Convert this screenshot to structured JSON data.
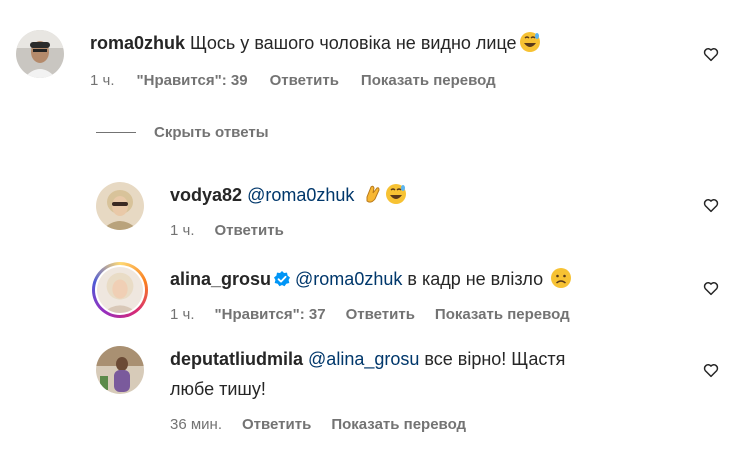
{
  "comments": [
    {
      "username": "roma0zhuk",
      "text": "Щось у вашого чоловіка не видно лице",
      "emoji": "grinning-sweat-emoji",
      "time": "1 ч.",
      "likes": "\"Нравится\": 39",
      "reply": "Ответить",
      "translate": "Показать перевод"
    },
    {
      "username": "vodya82",
      "mention": "@roma0zhuk",
      "emoji": [
        "clapping-hand-emoji",
        "grinning-sweat-emoji"
      ],
      "time": "1 ч.",
      "reply": "Ответить"
    },
    {
      "username": "alina_grosu",
      "verified": true,
      "mention": "@roma0zhuk",
      "text": "в кадр не влізло",
      "emoji": "sad-face-emoji",
      "time": "1 ч.",
      "likes": "\"Нравится\": 37",
      "reply": "Ответить",
      "translate": "Показать перевод"
    },
    {
      "username": "deputatliudmila",
      "mention": "@alina_grosu",
      "text": "все вірно! Щастя",
      "text2": "любе тишу!",
      "time": "36 мин.",
      "reply": "Ответить",
      "translate": "Показать перевод"
    }
  ],
  "hide_replies": "Скрыть ответы",
  "colors": {
    "text": "#262626",
    "secondary": "#737373",
    "mention": "#00376b",
    "verified": "#0095f6"
  }
}
